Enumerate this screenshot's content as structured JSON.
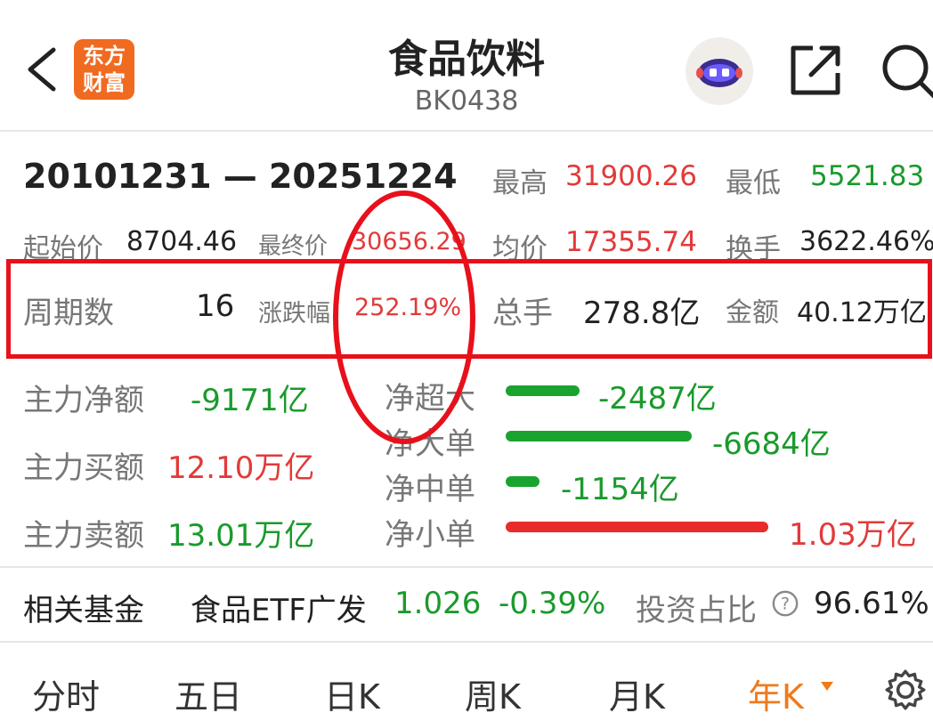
{
  "header": {
    "back_label": "",
    "logo_text": [
      "东方",
      "财富"
    ],
    "title": "食品饮料",
    "code": "BK0438"
  },
  "summary": {
    "date_range": "20101231 — 20251224",
    "high_label": "最高",
    "high_value": "31900.26",
    "low_label": "最低",
    "low_value": "5521.83",
    "start_label": "起始价",
    "start_value": "8704.46",
    "end_label": "最终价",
    "end_value": "30656.29",
    "avg_label": "均价",
    "avg_value": "17355.74",
    "turnover_label": "换手",
    "turnover_value": "3622.46%",
    "periods_label": "周期数",
    "periods_value": "16",
    "change_label": "涨跌幅",
    "change_value": "252.19%",
    "volume_label": "总手",
    "volume_value": "278.8亿",
    "amount_label": "金额",
    "amount_value": "40.12万亿"
  },
  "flows": {
    "main_net_label": "主力净额",
    "main_net_value": "-9171亿",
    "main_buy_label": "主力买额",
    "main_buy_value": "12.10万亿",
    "main_sell_label": "主力卖额",
    "main_sell_value": "13.01万亿",
    "rows": [
      {
        "label": "净超大",
        "value": "-2487亿",
        "ratio": 0.28,
        "color": "#1aa32e"
      },
      {
        "label": "净大单",
        "value": "-6684亿",
        "ratio": 0.71,
        "color": "#1aa32e"
      },
      {
        "label": "净中单",
        "value": "-1154亿",
        "ratio": 0.13,
        "color": "#1aa32e"
      },
      {
        "label": "净小单",
        "value": "1.03万亿",
        "ratio": 1.0,
        "color": "#e82c2c"
      }
    ]
  },
  "fund": {
    "label": "相关基金",
    "name": "食品ETF广发",
    "price": "1.026",
    "change": "-0.39%",
    "ratio_label": "投资占比",
    "ratio_value": "96.61%"
  },
  "tabs": {
    "fenshi": "分时",
    "wuri": "五日",
    "rik": "日K",
    "zhouk": "周K",
    "yuek": "月K",
    "niank": "年K",
    "active": "niank"
  }
}
